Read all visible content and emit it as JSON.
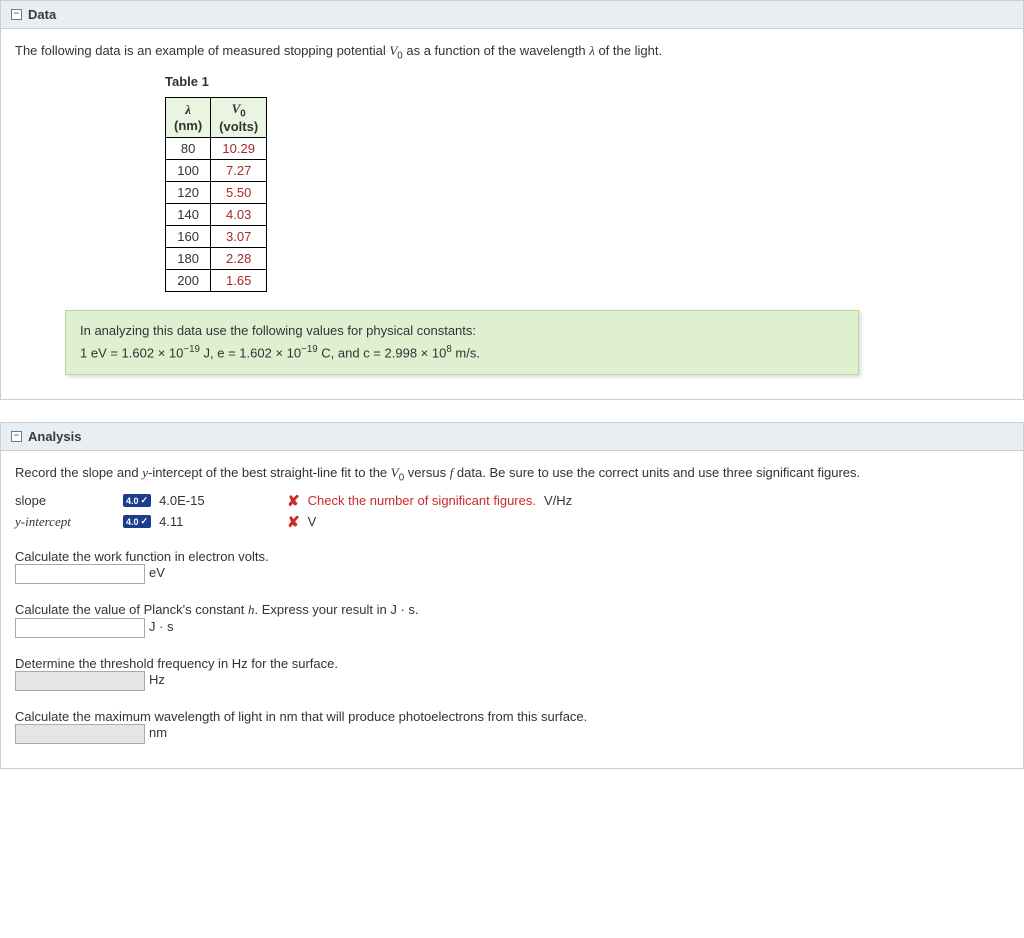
{
  "sections": {
    "data": {
      "title": "Data",
      "intro_prefix": "The following data is an example of measured stopping potential ",
      "intro_var": "V",
      "intro_sub": "0",
      "intro_mid": " as a function of the wavelength ",
      "intro_lambda": "λ",
      "intro_suffix": " of the light.",
      "table_title": "Table 1",
      "table_head_col1_sym": "λ",
      "table_head_col1_unit": "(nm)",
      "table_head_col2_sym": "V",
      "table_head_col2_sub": "0",
      "table_head_col2_unit": "(volts)",
      "rows": [
        {
          "l": "80",
          "v": "10.29"
        },
        {
          "l": "100",
          "v": "7.27"
        },
        {
          "l": "120",
          "v": "5.50"
        },
        {
          "l": "140",
          "v": "4.03"
        },
        {
          "l": "160",
          "v": "3.07"
        },
        {
          "l": "180",
          "v": "2.28"
        },
        {
          "l": "200",
          "v": "1.65"
        }
      ],
      "constants_line1": "In analyzing this data use the following values for physical constants:",
      "constants_line2_a": "1 eV = 1.602 × 10",
      "constants_line2_a_sup": "−19",
      "constants_line2_b": " J,   e = 1.602 × 10",
      "constants_line2_b_sup": "−19",
      "constants_line2_c": " C,   and   c = 2.998 × 10",
      "constants_line2_c_sup": "8",
      "constants_line2_d": " m/s."
    },
    "analysis": {
      "title": "Analysis",
      "instr_a": "Record the slope and ",
      "instr_b": "y",
      "instr_c": "-intercept of the best straight-line fit to the ",
      "instr_d": "V",
      "instr_d_sub": "0",
      "instr_e": " versus ",
      "instr_f": "f",
      "instr_g": " data. Be sure to use the correct units and use three significant figures.",
      "slope_label": "slope",
      "slope_badge": "4.0",
      "slope_value": "4.0E-15",
      "slope_feedback": "Check the number of significant figures.",
      "slope_unit": "V/Hz",
      "yint_label": "y-intercept",
      "yint_badge": "4.0",
      "yint_value": "4.11",
      "yint_unit": "V",
      "q_work": "Calculate the work function in electron volts.",
      "q_work_unit": "eV",
      "q_planck_a": "Calculate the value of Planck's constant ",
      "q_planck_b": "h",
      "q_planck_c": ". Express your result in J · s.",
      "q_planck_unit": "J · s",
      "q_threshold": "Determine the threshold frequency in Hz for the surface.",
      "q_threshold_unit": "Hz",
      "q_maxwave": "Calculate the maximum wavelength of light in nm that will produce photoelectrons from this surface.",
      "q_maxwave_unit": "nm"
    }
  }
}
